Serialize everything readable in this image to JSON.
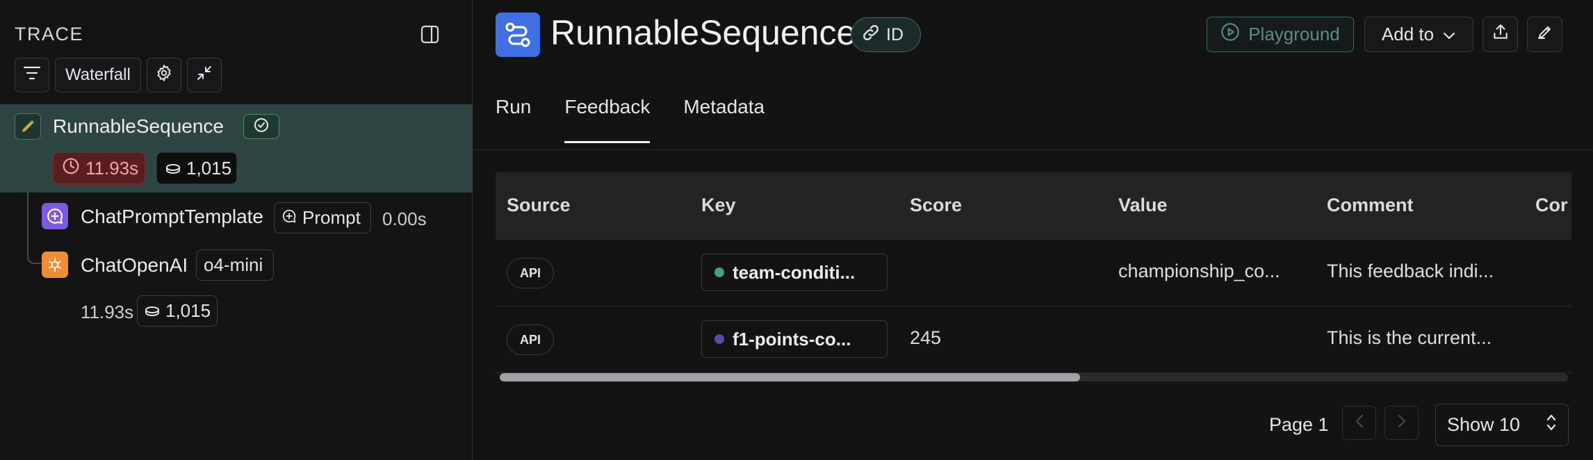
{
  "trace_panel": {
    "title": "TRACE",
    "toolbar": {
      "view_label": "Waterfall"
    },
    "nodes": [
      {
        "name": "RunnableSequence",
        "latency": "11.93s",
        "tokens": "1,015"
      },
      {
        "name": "ChatPromptTemplate",
        "type_label": "Prompt",
        "latency": "0.00s"
      },
      {
        "name": "ChatOpenAI",
        "model": "o4-mini",
        "latency": "11.93s",
        "tokens": "1,015"
      }
    ]
  },
  "header": {
    "title": "RunnableSequence",
    "id_label": "ID",
    "playground_label": "Playground",
    "add_to_label": "Add to"
  },
  "tabs": [
    {
      "label": "Run"
    },
    {
      "label": "Feedback",
      "active": true
    },
    {
      "label": "Metadata"
    }
  ],
  "feedback_table": {
    "columns": [
      "Source",
      "Key",
      "Score",
      "Value",
      "Comment",
      "Cor"
    ],
    "rows": [
      {
        "source": "API",
        "key": "team-conditi...",
        "key_color": "#4f9d80",
        "score": "",
        "value": "championship_co...",
        "comment": "This feedback indi..."
      },
      {
        "source": "API",
        "key": "f1-points-co...",
        "key_color": "#5b4aa8",
        "score": "245",
        "value": "",
        "comment": "This is the current..."
      }
    ]
  },
  "pagination": {
    "page_label": "Page 1",
    "show_label": "Show 10"
  },
  "colors": {
    "accent_blue": "#3f6fe4",
    "selected_row": "#2d4644",
    "latency_warn": "#5a1e1e"
  }
}
